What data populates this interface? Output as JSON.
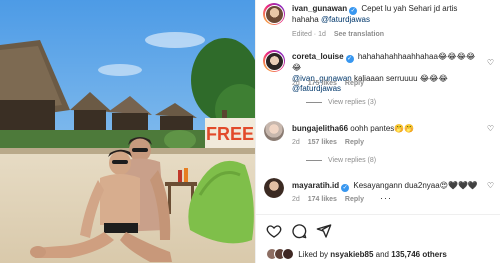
{
  "post": {
    "caption_user": "ivan_gunawan",
    "caption_text": "Cepet lu yah Sehari jd artis hahaha",
    "caption_mention": "@faturdjawas",
    "edited_age": "Edited · 1d",
    "see_translation": "See translation",
    "photo_sign_text": "FREE"
  },
  "comments": [
    {
      "user": "coreta_louise",
      "verified": true,
      "text": "hahahahahhaahhahaa😂😂😂😂😂",
      "line2_mention": "@ivan_gunawan",
      "line2_text": " kaliaaan serruuuu 😂😂😂 ",
      "line2_mention2": "@faturdjawas",
      "age": "2d",
      "likes": "175 likes",
      "reply": "Reply",
      "view_replies": "View replies (3)"
    },
    {
      "user": "bungajelitha66",
      "verified": false,
      "text": "oohh pantes🤭🤭",
      "age": "2d",
      "likes": "157 likes",
      "reply": "Reply",
      "view_replies": "View replies (8)"
    },
    {
      "user": "mayaratih.id",
      "verified": true,
      "text": "Kesayangann dua2nyaa😍🖤🖤🖤",
      "age": "2d",
      "likes": "174 likes",
      "reply": "Reply",
      "more": "···"
    }
  ],
  "likes_bar": {
    "liked_by_prefix": "Liked by ",
    "liked_by_user": "nsyakieb85",
    "and_text": " and ",
    "others": "135,746 others"
  },
  "icons": {
    "heart": "heart-icon",
    "comment": "comment-icon",
    "share": "share-icon",
    "verified": "verified-badge-icon"
  },
  "colors": {
    "mention": "#00376b",
    "verified": "#3897f0",
    "muted": "#8e8e8e"
  }
}
